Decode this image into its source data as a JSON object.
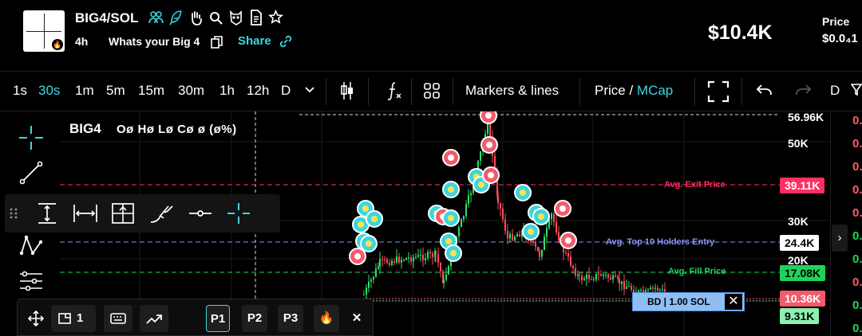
{
  "header": {
    "pair": "BIG4/SOL",
    "timeframe": "4h",
    "description": "Whats your Big 4",
    "share_label": "Share",
    "market_cap": "$10.4K",
    "price_label": "Price",
    "price_value": "$0.0₄1"
  },
  "toolbar": {
    "intervals": [
      "1s",
      "30s",
      "1m",
      "5m",
      "15m",
      "30m",
      "1h",
      "12h",
      "D"
    ],
    "active_interval": "30s",
    "markers_label": "Markers & lines",
    "price_label": "Price",
    "price_sep": " / ",
    "mcap_label": "MCap",
    "right_label": "D"
  },
  "chart": {
    "title": "BIG4",
    "ohlc": "Oø Hø Lø Cø ø (ø%)",
    "axis_labels": [
      "56.96K",
      "50K",
      "30K",
      "20K"
    ],
    "tags": {
      "exit": "39.11K",
      "top10": "24.4K",
      "fill": "17.08K",
      "current": "10.36K",
      "low": "9.31K"
    },
    "line_notes": {
      "exit": "Avg. Exit Price",
      "top10": "Avg. Top 10 Holders Entry",
      "fill": "Avg. Fill Price"
    },
    "order_label": "BD | 1.00 SOL",
    "order_close": "✕",
    "colors": {
      "exit": "#ff2e63",
      "top10": "#8a93f5",
      "fill": "#1ed35a",
      "current": "#f25b6b",
      "low": "#8ef0b0",
      "accent": "#3cd5e0"
    }
  },
  "right_values": [
    "0.",
    "0.",
    "0.",
    "0.",
    "0.",
    "0.",
    "0.",
    "0.",
    "0.",
    "0."
  ],
  "bottom": {
    "layout_count": "1",
    "presets": [
      "P1",
      "P2",
      "P3"
    ],
    "active_preset": "P1",
    "close": "✕"
  },
  "icons": {
    "header": [
      "users-icon",
      "feather-icon",
      "wave-hand-icon",
      "search-icon",
      "owl-icon",
      "document-icon",
      "star-icon"
    ],
    "left_tools": [
      "crosshair-icon",
      "trend-line-icon",
      "pattern-icon",
      "measure-icon"
    ],
    "draw_tools": [
      "vertical-range-icon",
      "horizontal-range-icon",
      "grid-select-icon",
      "brush-icon",
      "horizontal-ray-icon",
      "crosshair-icon"
    ]
  }
}
